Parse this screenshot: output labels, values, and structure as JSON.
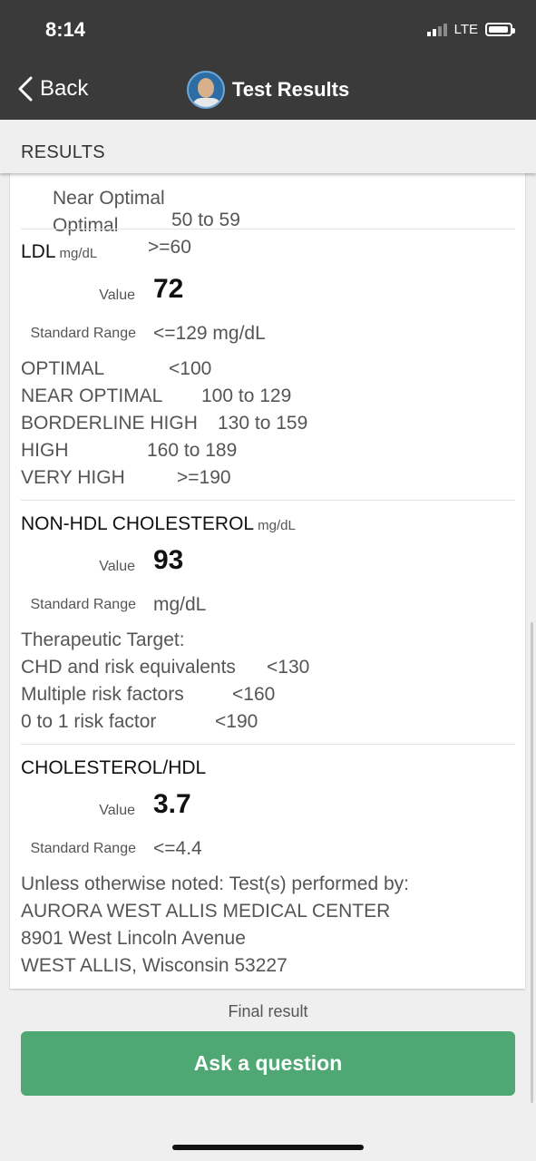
{
  "status_bar": {
    "time": "8:14",
    "network": "LTE"
  },
  "nav": {
    "back_label": "Back",
    "title": "Test Results"
  },
  "section": {
    "label": "RESULTS"
  },
  "hdl_tail": [
    {
      "label": "Near Optimal",
      "range": "50 to 59"
    },
    {
      "label": "Optimal",
      "range": ">=60"
    }
  ],
  "ldl": {
    "name": "LDL",
    "unit": "mg/dL",
    "value_label": "Value",
    "value": "72",
    "range_label": "Standard Range",
    "range": "<=129 mg/dL",
    "ranges": [
      {
        "label": "OPTIMAL",
        "range": "<100"
      },
      {
        "label": "NEAR OPTIMAL",
        "range": "100 to 129"
      },
      {
        "label": "BORDERLINE HIGH",
        "range": "130 to 159"
      },
      {
        "label": "HIGH",
        "range": "160 to 189"
      },
      {
        "label": "VERY HIGH",
        "range": ">=190"
      }
    ]
  },
  "non_hdl": {
    "name": "NON-HDL CHOLESTEROL",
    "unit": "mg/dL",
    "value_label": "Value",
    "value": "93",
    "range_label": "Standard Range",
    "range": "mg/dL",
    "target_heading": "Therapeutic Target:",
    "targets": [
      {
        "label": "CHD and risk equivalents",
        "range": "<130"
      },
      {
        "label": "Multiple risk factors",
        "range": "<160"
      },
      {
        "label": "0 to 1 risk factor",
        "range": "<190"
      }
    ]
  },
  "ratio": {
    "name": "CHOLESTEROL/HDL",
    "value_label": "Value",
    "value": "3.7",
    "range_label": "Standard Range",
    "range": "<=4.4",
    "notes": [
      "Unless otherwise noted: Test(s) performed by:",
      "AURORA WEST ALLIS MEDICAL CENTER",
      "8901 West Lincoln Avenue",
      "WEST ALLIS, Wisconsin 53227"
    ]
  },
  "footer": {
    "status": "Final result",
    "ask_button": "Ask a question"
  }
}
